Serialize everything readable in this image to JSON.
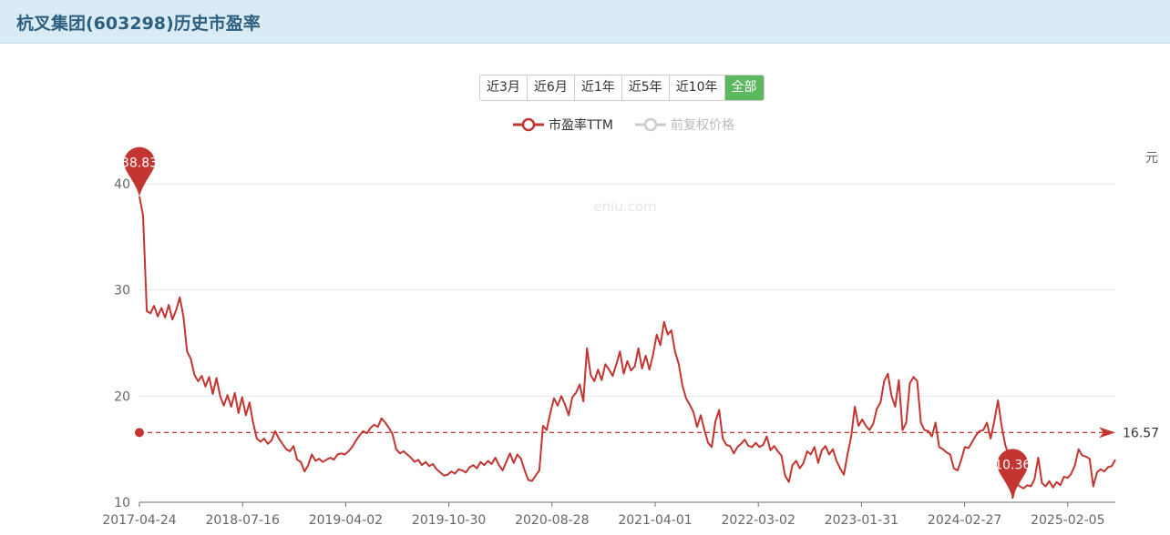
{
  "header": {
    "title": "杭叉集团(603298)历史市盈率"
  },
  "range_buttons": [
    {
      "label": "近3月",
      "active": false
    },
    {
      "label": "近6月",
      "active": false
    },
    {
      "label": "近1年",
      "active": false
    },
    {
      "label": "近5年",
      "active": false
    },
    {
      "label": "近10年",
      "active": false
    },
    {
      "label": "全部",
      "active": true
    }
  ],
  "legend": [
    {
      "label": "市盈率TTM",
      "color": "#c23531",
      "active": true
    },
    {
      "label": "前复权价格",
      "color": "#cccccc",
      "active": false
    }
  ],
  "watermark": "eniu.com",
  "right_axis_label": "元",
  "colors": {
    "line": "#c23531",
    "accent": "#5cb85c",
    "grid": "#e0e6f1"
  },
  "chart_data": {
    "type": "line",
    "title": "",
    "xlabel": "",
    "ylabel": "",
    "ylim": [
      10,
      40
    ],
    "yticks": [
      10,
      20,
      30,
      40
    ],
    "grid": true,
    "legend_position": "top-center",
    "x_tick_labels": [
      "2017-04-24",
      "2018-07-16",
      "2019-04-02",
      "2019-10-30",
      "2020-08-28",
      "2021-04-01",
      "2022-03-02",
      "2023-01-31",
      "2024-02-27",
      "2025-02-05"
    ],
    "max_marker": {
      "label": "38.83",
      "value": 38.83
    },
    "min_marker": {
      "label": "10.36",
      "value": 10.36
    },
    "average_line": {
      "label": "16.57",
      "value": 16.57
    },
    "series": [
      {
        "name": "市盈率TTM",
        "values": [
          38.83,
          37.0,
          28.0,
          27.8,
          28.5,
          27.5,
          28.3,
          27.4,
          28.6,
          27.2,
          28.1,
          29.3,
          27.5,
          24.2,
          23.5,
          22.0,
          21.4,
          21.9,
          20.9,
          21.8,
          20.2,
          21.7,
          20.0,
          19.1,
          20.1,
          19.0,
          20.3,
          18.4,
          19.9,
          18.2,
          19.4,
          17.5,
          16.0,
          15.7,
          16.0,
          15.5,
          15.8,
          16.7,
          16.0,
          15.5,
          15.0,
          14.8,
          15.3,
          14.0,
          13.8,
          12.9,
          13.5,
          14.5,
          13.9,
          14.1,
          13.8,
          14.0,
          14.2,
          14.0,
          14.5,
          14.6,
          14.5,
          14.8,
          15.2,
          15.8,
          16.3,
          16.7,
          16.5,
          17.0,
          17.3,
          17.1,
          17.9,
          17.5,
          17.0,
          16.4,
          15.0,
          14.6,
          14.8,
          14.5,
          14.2,
          13.8,
          14.0,
          13.5,
          13.8,
          13.4,
          13.6,
          13.1,
          12.8,
          12.5,
          12.6,
          12.9,
          12.7,
          13.1,
          13.0,
          12.8,
          13.3,
          13.5,
          13.2,
          13.8,
          13.5,
          13.9,
          13.6,
          14.2,
          13.5,
          13.0,
          13.8,
          14.6,
          13.7,
          14.5,
          14.1,
          13.0,
          12.1,
          12.0,
          12.5,
          13.0,
          17.2,
          16.8,
          18.4,
          19.8,
          19.1,
          20.0,
          19.2,
          18.2,
          19.9,
          20.3,
          21.1,
          19.5,
          24.5,
          22.0,
          21.4,
          22.5,
          21.5,
          23.0,
          22.5,
          21.9,
          23.0,
          24.2,
          22.1,
          23.3,
          22.4,
          22.8,
          24.5,
          22.6,
          23.8,
          22.5,
          23.9,
          25.8,
          24.8,
          27.0,
          25.8,
          26.2,
          24.2,
          23.0,
          21.0,
          19.8,
          19.2,
          18.5,
          17.1,
          18.2,
          16.8,
          15.6,
          15.2,
          17.6,
          18.7,
          16.0,
          15.4,
          15.3,
          14.6,
          15.2,
          15.5,
          15.9,
          15.3,
          15.2,
          15.6,
          15.2,
          15.4,
          16.2,
          14.9,
          15.3,
          14.8,
          14.4,
          12.5,
          11.9,
          13.5,
          13.9,
          13.2,
          13.7,
          14.8,
          14.5,
          15.2,
          13.7,
          14.9,
          15.3,
          14.5,
          15.0,
          13.9,
          13.2,
          12.6,
          14.5,
          16.2,
          19.0,
          17.2,
          17.8,
          17.2,
          16.8,
          17.4,
          18.8,
          19.4,
          21.4,
          22.1,
          20.0,
          19.0,
          21.5,
          16.8,
          17.5,
          21.2,
          21.8,
          21.4,
          17.5,
          16.8,
          16.7,
          16.2,
          17.5,
          15.2,
          15.0,
          14.7,
          14.5,
          13.2,
          13.0,
          14.0,
          15.2,
          15.1,
          15.7,
          16.3,
          16.7,
          16.8,
          17.5,
          16.0,
          17.6,
          19.6,
          17.2,
          15.4,
          14.3,
          10.4,
          11.8,
          11.5,
          11.3,
          11.6,
          11.5,
          12.2,
          14.2,
          11.8,
          11.5,
          12.0,
          11.4,
          11.9,
          11.6,
          12.4,
          12.3,
          12.7,
          13.5,
          15.0,
          14.4,
          14.3,
          14.1,
          11.5,
          12.8,
          13.1,
          12.9,
          13.3,
          13.4,
          14.0
        ]
      }
    ]
  }
}
